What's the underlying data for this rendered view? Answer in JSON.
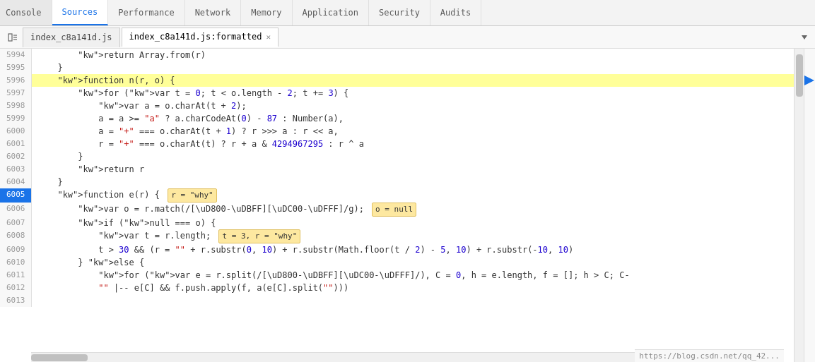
{
  "tabs": {
    "items": [
      {
        "label": "Console",
        "active": false
      },
      {
        "label": "Sources",
        "active": true
      },
      {
        "label": "Performance",
        "active": false
      },
      {
        "label": "Network",
        "active": false
      },
      {
        "label": "Memory",
        "active": false
      },
      {
        "label": "Application",
        "active": false
      },
      {
        "label": "Security",
        "active": false
      },
      {
        "label": "Audits",
        "active": false
      }
    ]
  },
  "filetabs": {
    "items": [
      {
        "label": "index_c8a141d.js",
        "active": false,
        "closeable": false
      },
      {
        "label": "index_c8a141d.js:formatted",
        "active": true,
        "closeable": true
      }
    ]
  },
  "code": {
    "lines": [
      {
        "num": "5994",
        "content": "        return Array.from(r)",
        "highlighted": false,
        "current": false
      },
      {
        "num": "5995",
        "content": "    }",
        "highlighted": false,
        "current": false
      },
      {
        "num": "5996",
        "content": "    function n(r, o) {",
        "highlighted": true,
        "current": false
      },
      {
        "num": "5997",
        "content": "        for (var t = 0; t < o.length - 2; t += 3) {",
        "highlighted": false,
        "current": false
      },
      {
        "num": "5998",
        "content": "            var a = o.charAt(t + 2);",
        "highlighted": false,
        "current": false
      },
      {
        "num": "5999",
        "content": "            a = a >= \"a\" ? a.charCodeAt(0) - 87 : Number(a),",
        "highlighted": false,
        "current": false
      },
      {
        "num": "6000",
        "content": "            a = \"+\" === o.charAt(t + 1) ? r >>> a : r << a,",
        "highlighted": false,
        "current": false
      },
      {
        "num": "6001",
        "content": "            r = \"+\" === o.charAt(t) ? r + a & 4294967295 : r ^ a",
        "highlighted": false,
        "current": false
      },
      {
        "num": "6002",
        "content": "        }",
        "highlighted": false,
        "current": false
      },
      {
        "num": "6003",
        "content": "        return r",
        "highlighted": false,
        "current": false
      },
      {
        "num": "6004",
        "content": "    }",
        "highlighted": false,
        "current": false
      },
      {
        "num": "6005",
        "content": "    function e(r) {",
        "highlighted": false,
        "current": true,
        "tooltip1": "r = \"why\""
      },
      {
        "num": "6006",
        "content": "        var o = r.match(/[\\uD800-\\uDBFF][\\uDC00-\\uDFFF]/g);",
        "highlighted": false,
        "current": false,
        "tooltip2": "o = null"
      },
      {
        "num": "6007",
        "content": "        if (null === o) {",
        "highlighted": false,
        "current": false
      },
      {
        "num": "6008",
        "content": "            var t = r.length;",
        "highlighted": false,
        "current": false,
        "tooltip3": "t = 3, r = \"why\""
      },
      {
        "num": "6009",
        "content": "            t > 30 && (r = \"\" + r.substr(0, 10) + r.substr(Math.floor(t / 2) - 5, 10) + r.substr(-10, 10)",
        "highlighted": false,
        "current": false
      },
      {
        "num": "6010",
        "content": "        } else {",
        "highlighted": false,
        "current": false
      },
      {
        "num": "6011",
        "content": "            for (var e = r.split(/[\\uD800-\\uDBFF][\\uDC00-\\uDFFF]/), C = 0, h = e.length, f = []; h > C; C-",
        "highlighted": false,
        "current": false
      },
      {
        "num": "6012",
        "content": "            \"\" |-- e[C] && f.push.apply(f, a(e[C].split(\"\")))",
        "highlighted": false,
        "current": false
      },
      {
        "num": "6013",
        "content": "",
        "highlighted": false,
        "current": false
      }
    ]
  },
  "statusbar": {
    "url": "https://blog.csdn.net/qq_42..."
  }
}
